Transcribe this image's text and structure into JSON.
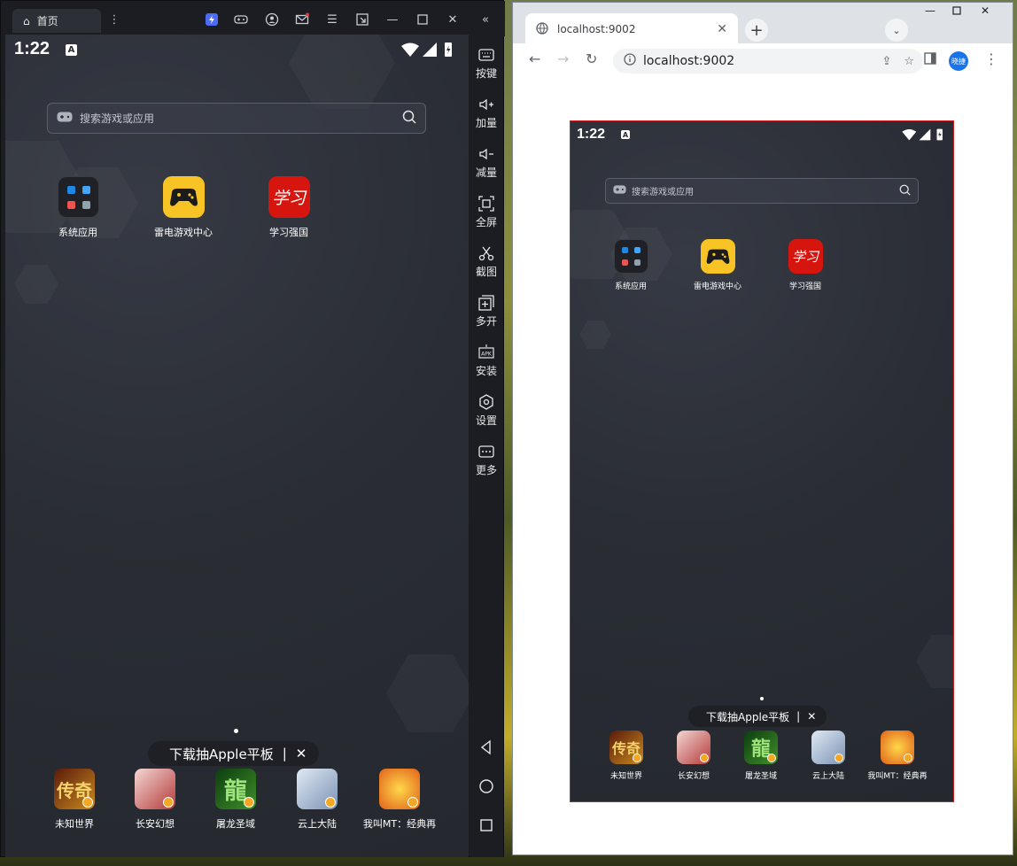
{
  "emulator": {
    "home_tab": "首页",
    "status_time": "1:22",
    "status_a": "A",
    "search_placeholder": "搜索游戏或应用",
    "apps": [
      {
        "label": "系统应用",
        "icon": "system-apps-folder-icon"
      },
      {
        "label": "雷电游戏中心",
        "icon": "ldplayer-game-center-icon"
      },
      {
        "label": "学习强国",
        "icon": "xuexi-qiangguo-icon"
      }
    ],
    "banner": "下载抽Apple平板",
    "banner_sep": "|",
    "banner_close": "✕",
    "dock": [
      {
        "label": "未知世界"
      },
      {
        "label": "长安幻想"
      },
      {
        "label": "屠龙圣域"
      },
      {
        "label": "云上大陆"
      },
      {
        "label": "我叫MT：经典再"
      }
    ],
    "sidebar": [
      {
        "label": "按键",
        "icon": "keyboard-icon"
      },
      {
        "label": "加量",
        "icon": "volume-up-icon"
      },
      {
        "label": "减量",
        "icon": "volume-down-icon"
      },
      {
        "label": "全屏",
        "icon": "fullscreen-icon"
      },
      {
        "label": "截图",
        "icon": "scissors-icon"
      },
      {
        "label": "多开",
        "icon": "multi-instance-icon"
      },
      {
        "label": "安装",
        "icon": "apk-install-icon"
      },
      {
        "label": "设置",
        "icon": "settings-icon"
      },
      {
        "label": "更多",
        "icon": "more-icon"
      }
    ]
  },
  "browser": {
    "tab_title": "localhost:9002",
    "url": "localhost:9002",
    "profile_label": "晓捷",
    "phone": {
      "status_time": "1:22",
      "status_a": "A",
      "search_placeholder": "搜索游戏或应用",
      "apps": [
        {
          "label": "系统应用"
        },
        {
          "label": "雷电游戏中心"
        },
        {
          "label": "学习强国"
        }
      ],
      "banner": "下载抽Apple平板",
      "banner_sep": "|",
      "banner_close": "✕",
      "dock": [
        {
          "label": "未知世界"
        },
        {
          "label": "长安幻想"
        },
        {
          "label": "屠龙圣域"
        },
        {
          "label": "云上大陆"
        },
        {
          "label": "我叫MT：经典再"
        }
      ]
    }
  },
  "colors": {
    "emulator_bg": "#1b1d22",
    "android_bg": "#2a2d35",
    "browser_frame": "#dee1e6",
    "phone_border": "#d01c1c",
    "game_center_yellow": "#f7c325",
    "xuexi_red": "#d7150f"
  }
}
